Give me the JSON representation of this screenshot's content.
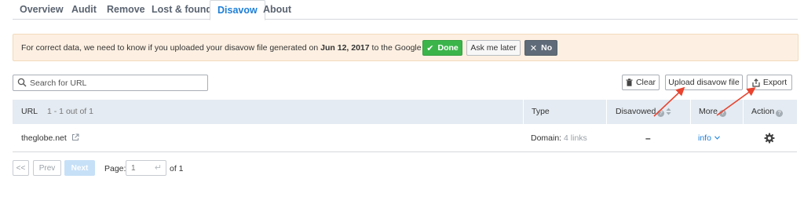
{
  "tabs": [
    {
      "label": "Overview",
      "active": false
    },
    {
      "label": "Audit",
      "active": false
    },
    {
      "label": "Remove",
      "active": false
    },
    {
      "label": "Lost & found",
      "active": false
    },
    {
      "label": "Disavow",
      "active": true
    },
    {
      "label": "About",
      "active": false
    }
  ],
  "notice": {
    "text_before": "For correct data, we need to know if you uploaded your disavow file generated on ",
    "date": "Jun 12, 2017",
    "text_after": " to the Google Disavow?",
    "done_label": "Done",
    "later_label": "Ask me later",
    "no_label": "No",
    "background_color": "#fdf0e2"
  },
  "search": {
    "placeholder": "Search for URL",
    "value": ""
  },
  "actions": {
    "clear_label": "Clear",
    "upload_label": "Upload disavow file",
    "export_label": "Export"
  },
  "table": {
    "columns": {
      "url": "URL",
      "url_count": "1 - 1 out of 1",
      "type": "Type",
      "disavowed": "Disavowed",
      "more": "More",
      "action": "Action"
    },
    "rows": [
      {
        "url": "theglobe.net",
        "type_label": "Domain:",
        "type_links": "4 links",
        "disavowed": "–",
        "more": "info"
      }
    ]
  },
  "pagination": {
    "first": "<<",
    "prev": "Prev",
    "next": "Next",
    "page_label": "Page:",
    "page_placeholder": "1",
    "of_label": "of 1"
  },
  "colors": {
    "accent": "#1d7fd8",
    "done_green": "#3bb54a",
    "no_gray": "#5f6b78",
    "header_bg": "#e4ebf2",
    "annotation_arrow": "#e8442f"
  },
  "icons": {
    "done": "check-icon",
    "no": "x-icon",
    "search": "search-icon",
    "clear": "trash-icon",
    "export": "export-icon",
    "external": "external-link-icon",
    "action": "gear-icon"
  }
}
